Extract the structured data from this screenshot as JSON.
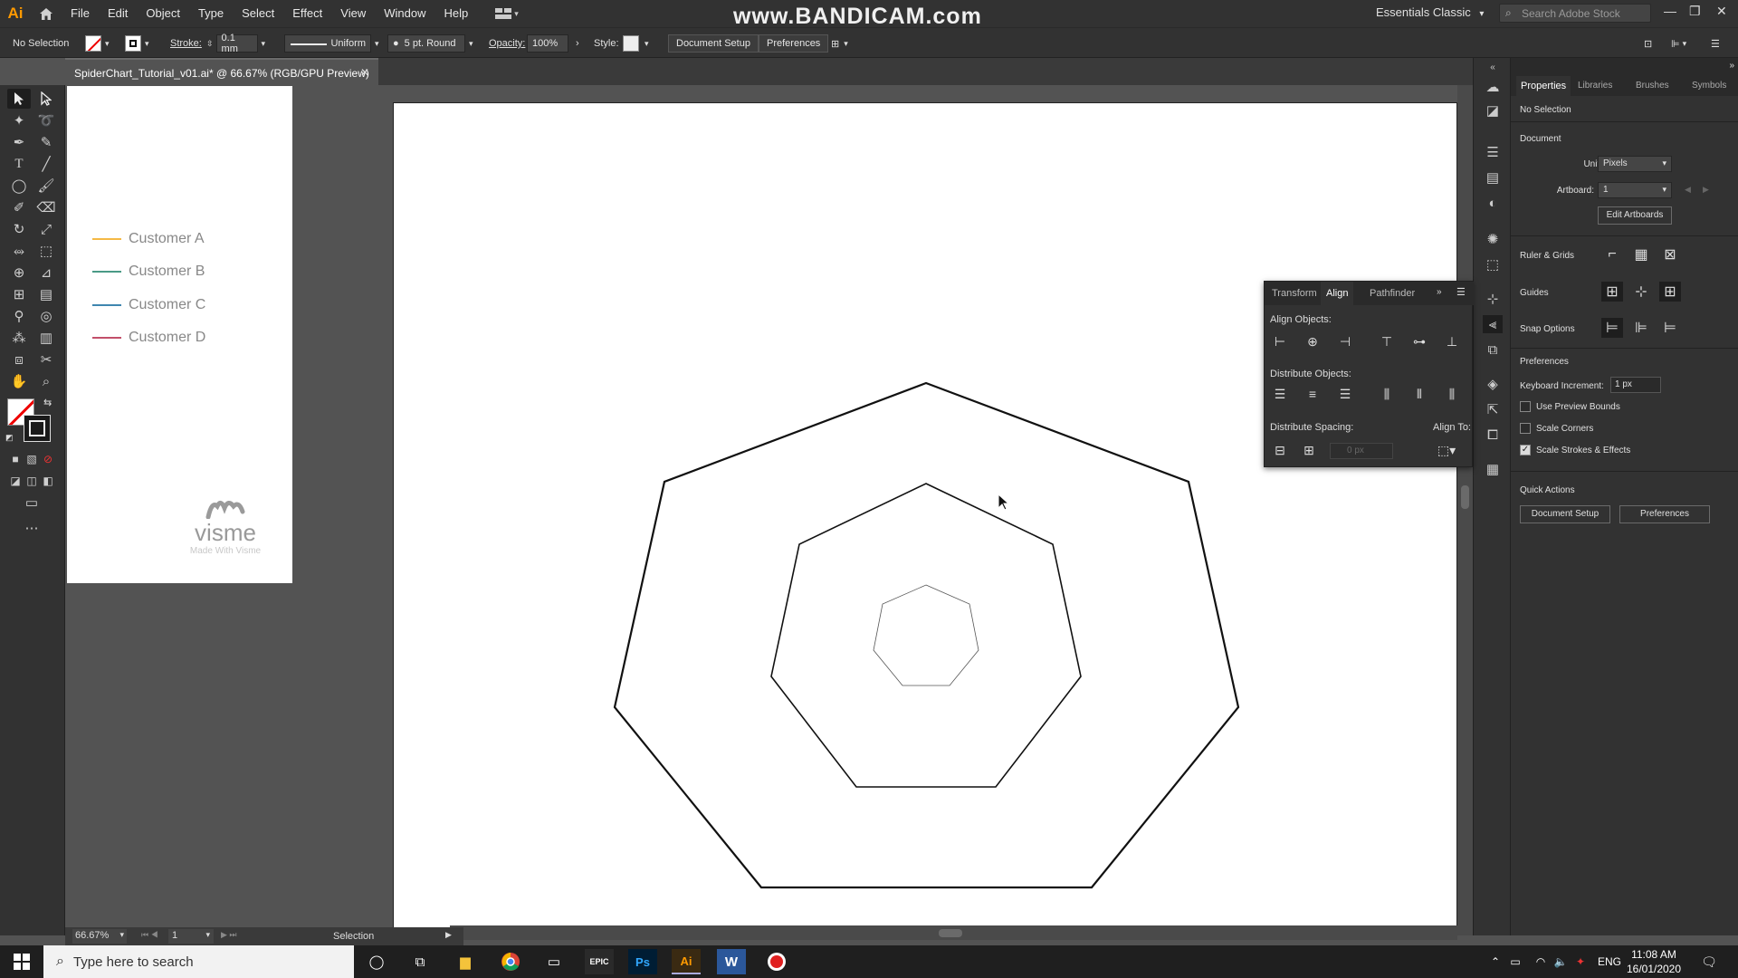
{
  "app": {
    "logo": "Ai",
    "watermark": "www.BANDICAM.com",
    "workspace": "Essentials Classic",
    "stock_placeholder": "Search Adobe Stock"
  },
  "menu": [
    "File",
    "Edit",
    "Object",
    "Type",
    "Select",
    "Effect",
    "View",
    "Window",
    "Help"
  ],
  "control": {
    "selection": "No Selection",
    "stroke_label": "Stroke:",
    "stroke_value": "0.1 mm",
    "profile": "Uniform",
    "brush": "5 pt. Round",
    "opacity_label": "Opacity:",
    "opacity_value": "100%",
    "style_label": "Style:",
    "doc_setup": "Document Setup",
    "preferences": "Preferences"
  },
  "document": {
    "tab_title": "SpiderChart_Tutorial_v01.ai* @ 66.67% (RGB/GPU Preview)"
  },
  "legend": [
    {
      "label": "Customer A",
      "color": "#f5b945"
    },
    {
      "label": "Customer B",
      "color": "#4a9a86"
    },
    {
      "label": "Customer C",
      "color": "#3f86b0"
    },
    {
      "label": "Customer D",
      "color": "#c2506a"
    }
  ],
  "visme": {
    "name": "visme",
    "tagline": "Made With Visme"
  },
  "status": {
    "zoom": "66.67%",
    "artboard": "1",
    "tool": "Selection"
  },
  "align_panel": {
    "tabs": [
      "Transform",
      "Align",
      "Pathfinder"
    ],
    "align_objects": "Align Objects:",
    "distribute_objects": "Distribute Objects:",
    "distribute_spacing": "Distribute Spacing:",
    "align_to": "Align To:",
    "spacing_value": "0 px"
  },
  "properties": {
    "tabs": [
      "Properties",
      "Libraries",
      "Brushes",
      "Symbols"
    ],
    "no_selection": "No Selection",
    "document": "Document",
    "units_label": "Units:",
    "units_value": "Pixels",
    "artboard_label": "Artboard:",
    "artboard_value": "1",
    "edit_artboards": "Edit Artboards",
    "ruler_grids": "Ruler & Grids",
    "guides": "Guides",
    "snap_options": "Snap Options",
    "preferences": "Preferences",
    "keyboard_increment_label": "Keyboard Increment:",
    "keyboard_increment_value": "1 px",
    "use_preview_bounds": "Use Preview Bounds",
    "scale_corners": "Scale Corners",
    "scale_strokes": "Scale Strokes & Effects",
    "quick_actions": "Quick Actions",
    "doc_setup": "Document Setup",
    "pref_btn": "Preferences"
  },
  "taskbar": {
    "search_placeholder": "Type here to search",
    "lang": "ENG",
    "time": "11:08 AM",
    "date": "16/01/2020"
  }
}
